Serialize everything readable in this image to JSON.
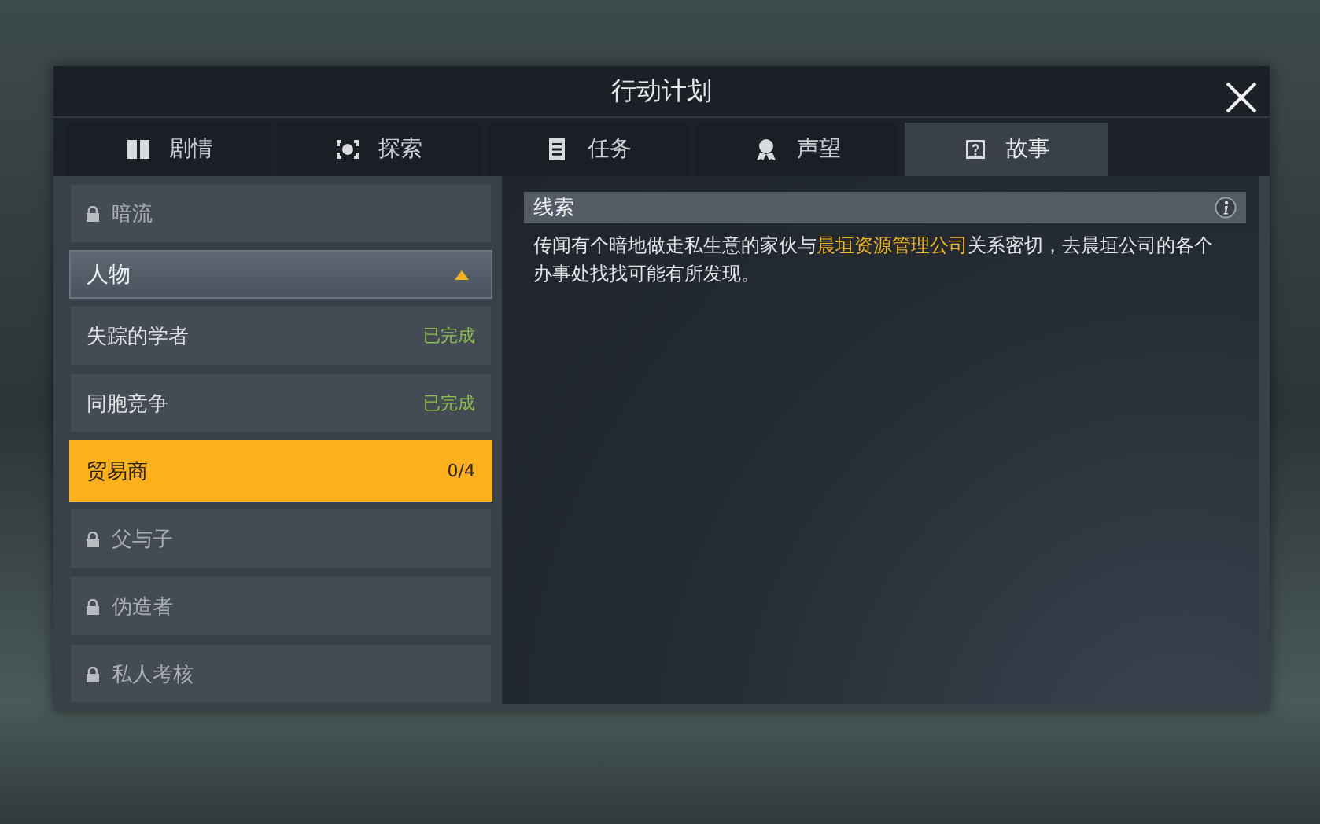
{
  "window": {
    "title": "行动计划"
  },
  "tabs": [
    {
      "kind": "book",
      "label": "剧情",
      "selected": false
    },
    {
      "kind": "target",
      "label": "探索",
      "selected": false
    },
    {
      "kind": "list",
      "label": "任务",
      "selected": false
    },
    {
      "kind": "badge",
      "label": "声望",
      "selected": false
    },
    {
      "kind": "note",
      "label": "故事",
      "selected": true
    }
  ],
  "sidebar": {
    "items": [
      {
        "kind": "item",
        "label": "暗流",
        "locked": true,
        "selected": false
      },
      {
        "kind": "group",
        "label": "人物",
        "expanded": true,
        "children": [
          {
            "kind": "item",
            "label": "失踪的学者",
            "locked": false,
            "selected": false,
            "status": "已完成"
          },
          {
            "kind": "item",
            "label": "同胞竞争",
            "locked": false,
            "selected": false,
            "status": "已完成"
          },
          {
            "kind": "item",
            "label": "贸易商",
            "locked": false,
            "selected": true,
            "status": "0/4"
          },
          {
            "kind": "item",
            "label": "父与子",
            "locked": true,
            "selected": false
          },
          {
            "kind": "item",
            "label": "伪造者",
            "locked": true,
            "selected": false
          },
          {
            "kind": "item",
            "label": "私人考核",
            "locked": true,
            "selected": false
          }
        ]
      }
    ]
  },
  "clue": {
    "title": "线索",
    "description": [
      {
        "kind": "plain",
        "text": "传闻有个暗地做走私生意的家伙与"
      },
      {
        "kind": "highlight",
        "text": "晨垣资源管理公司"
      },
      {
        "kind": "plain",
        "text": "关系密切，去晨垣公司的各个办事处找找可能有所发现。"
      }
    ]
  }
}
